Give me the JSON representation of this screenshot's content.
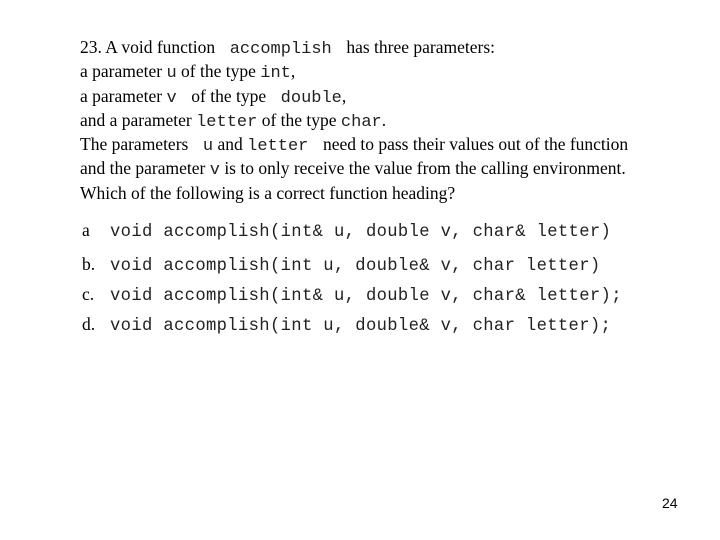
{
  "question": {
    "number": "23.",
    "lines": [
      [
        {
          "t": "serif",
          "v": "23. A void function "
        },
        {
          "t": "mono",
          "v": " accomplish "
        },
        {
          "t": "serif",
          "v": " has three parameters:"
        }
      ],
      [
        {
          "t": "serif",
          "v": "a parameter "
        },
        {
          "t": "mono",
          "v": "u"
        },
        {
          "t": "serif",
          "v": " of the type "
        },
        {
          "t": "mono",
          "v": "int"
        },
        {
          "t": "serif",
          "v": ","
        }
      ],
      [
        {
          "t": "serif",
          "v": "a parameter "
        },
        {
          "t": "mono",
          "v": "v "
        },
        {
          "t": "serif",
          "v": " of the type "
        },
        {
          "t": "mono",
          "v": " double"
        },
        {
          "t": "serif",
          "v": ","
        }
      ],
      [
        {
          "t": "serif",
          "v": "and a parameter "
        },
        {
          "t": "mono",
          "v": "letter"
        },
        {
          "t": "serif",
          "v": " of the type "
        },
        {
          "t": "mono",
          "v": "char"
        },
        {
          "t": "serif",
          "v": "."
        }
      ],
      [
        {
          "t": "serif",
          "v": "The parameters "
        },
        {
          "t": "mono",
          "v": " u"
        },
        {
          "t": "serif",
          "v": " and "
        },
        {
          "t": "mono",
          "v": "letter "
        },
        {
          "t": "serif",
          "v": " need to pass their values out of the function"
        }
      ],
      [
        {
          "t": "serif",
          "v": "and the parameter "
        },
        {
          "t": "mono",
          "v": "v"
        },
        {
          "t": "serif",
          "v": " is to only receive the value from the calling environment."
        }
      ],
      [
        {
          "t": "serif",
          "v": "Which of the following is a correct function heading?"
        }
      ]
    ]
  },
  "options": [
    {
      "label": "a",
      "code": "void accomplish(int& u, double v, char& letter)"
    },
    {
      "label": "b.",
      "code": "void accomplish(int u, double& v, char letter)"
    },
    {
      "label": "c.",
      "code": "void accomplish(int& u, double v, char& letter);"
    },
    {
      "label": "d.",
      "code": "void accomplish(int u, double& v, char letter);"
    }
  ],
  "page_number": "24"
}
